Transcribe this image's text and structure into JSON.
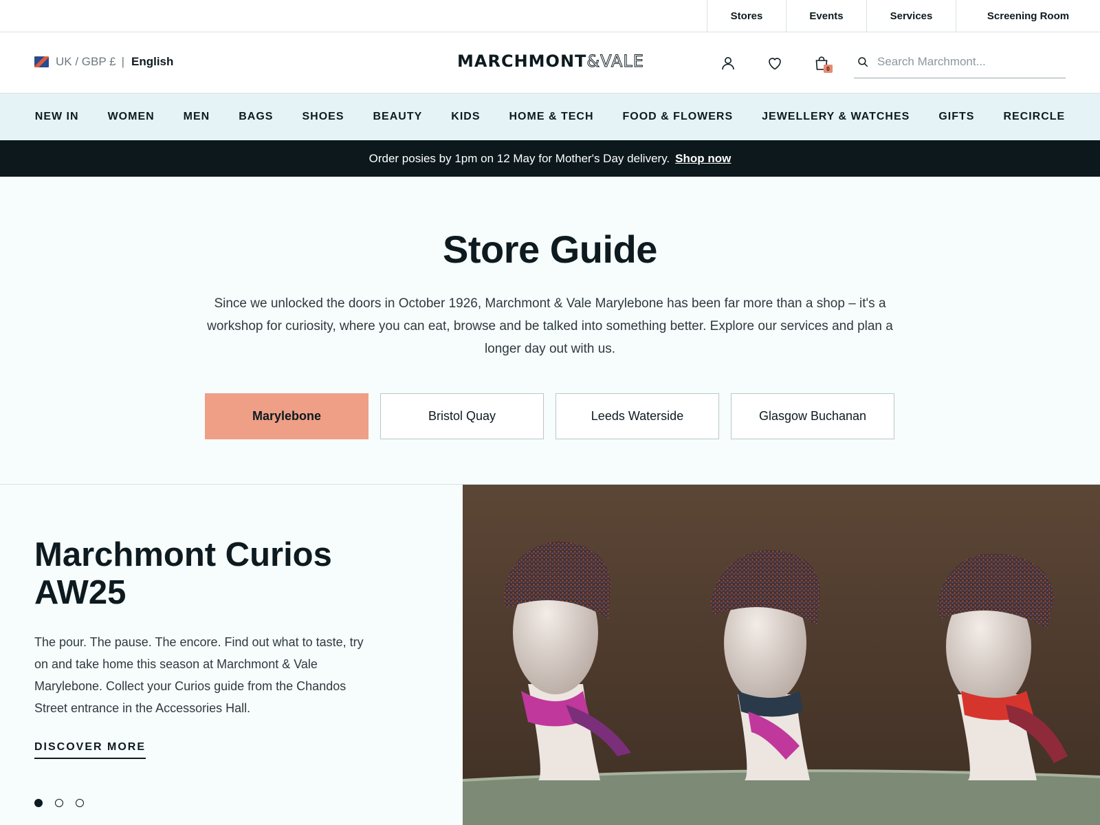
{
  "util_links": [
    "Stores",
    "Events",
    "Services",
    "Screening Room"
  ],
  "locale": {
    "currency": "UK / GBP £",
    "separator": "|",
    "language": "English"
  },
  "brand": {
    "logo_left": "MARCHMONT",
    "logo_amp": "&VALE"
  },
  "header": {
    "cart_count": "0",
    "search_placeholder": "Search Marchmont..."
  },
  "categories": [
    "NEW IN",
    "WOMEN",
    "MEN",
    "BAGS",
    "SHOES",
    "BEAUTY",
    "KIDS",
    "HOME & TECH",
    "FOOD & FLOWERS",
    "JEWELLERY & WATCHES",
    "GIFTS",
    "RECIRCLE"
  ],
  "promo": {
    "text": "Order posies by 1pm on 12 May for Mother's Day delivery.",
    "link": "Shop now"
  },
  "guide": {
    "title": "Store Guide",
    "description": "Since we unlocked the doors in October 1926, Marchmont & Vale Marylebone has been far more than a shop – it's a workshop for curiosity, where you can eat, browse and be talked into something better. Explore our services and plan a longer day out with us.",
    "stores": [
      "Marylebone",
      "Bristol Quay",
      "Leeds Waterside",
      "Glasgow Buchanan"
    ],
    "active_store": "Marylebone"
  },
  "feature": {
    "title": "Marchmont Curios AW25",
    "description": "The pour. The pause. The encore. Find out what to taste, try on and take home this season at Marchmont & Vale Marylebone. Collect your Curios guide from the Chandos Street entrance in the Accessories Hall.",
    "cta": "DISCOVER MORE",
    "slide_count": 3,
    "active_slide": 1
  },
  "colors": {
    "accent": "#ee9f86",
    "nav_bg": "#e5f2f6",
    "promo_bg": "#0d181c",
    "text": "#0d1a1f"
  }
}
